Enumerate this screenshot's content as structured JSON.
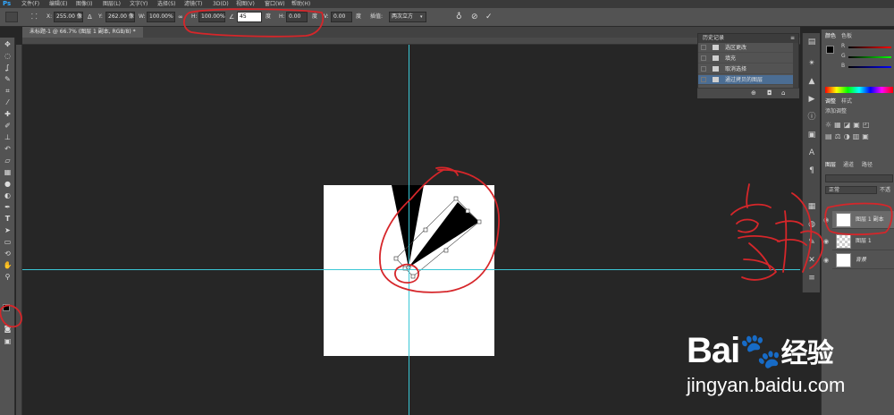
{
  "app": {
    "logo": "Ps"
  },
  "menu": [
    "文件(F)",
    "编辑(E)",
    "图像(I)",
    "图层(L)",
    "文字(Y)",
    "选择(S)",
    "滤镜(T)",
    "3D(D)",
    "视图(V)",
    "窗口(W)",
    "帮助(H)"
  ],
  "options": {
    "x_label": "X:",
    "x_value": "255.00 像",
    "y_label": "Y:",
    "y_value": "262.00 像",
    "w_label": "W:",
    "w_value": "100.00%",
    "h_label": "H:",
    "h_value": "100.00%",
    "angle_value": "45",
    "angle_unit": "度",
    "hskew_label": "H:",
    "hskew_value": "0.00",
    "hskew_unit": "度",
    "vskew_label": "V:",
    "vskew_value": "0.00",
    "vskew_unit": "度",
    "interp_label": "插值:",
    "interp_value": "两次立方"
  },
  "document_tab": {
    "title": "未标题-1 @ 66.7% (图层 1 副本, RGB/8) *"
  },
  "history": {
    "title": "历史记录",
    "items": [
      "选区更改",
      "填充",
      "取消选择",
      "通过拷贝的图层"
    ],
    "selected_index": 3
  },
  "color_panel": {
    "tab1": "颜色",
    "tab2": "色板"
  },
  "adjust_panel": {
    "tab1": "调整",
    "tab2": "样式",
    "subtitle": "添加调整"
  },
  "layers_panel": {
    "tabs": [
      "图层",
      "通道",
      "路径"
    ],
    "blend_mode": "正常",
    "opacity_label": "不透",
    "layers": [
      {
        "name": "图层 1 副本",
        "selected": true
      },
      {
        "name": "图层 1",
        "selected": false
      },
      {
        "name": "背景",
        "selected": false
      }
    ]
  },
  "watermark": {
    "brand_left": "Bai",
    "brand_right": "经验",
    "url": "jingyan.baidu.com"
  },
  "annotation_text": "复制",
  "colors": {
    "accent_guide": "#3ac7d6",
    "annotation_red": "#d6262a",
    "history_selected": "#4b6d93"
  }
}
